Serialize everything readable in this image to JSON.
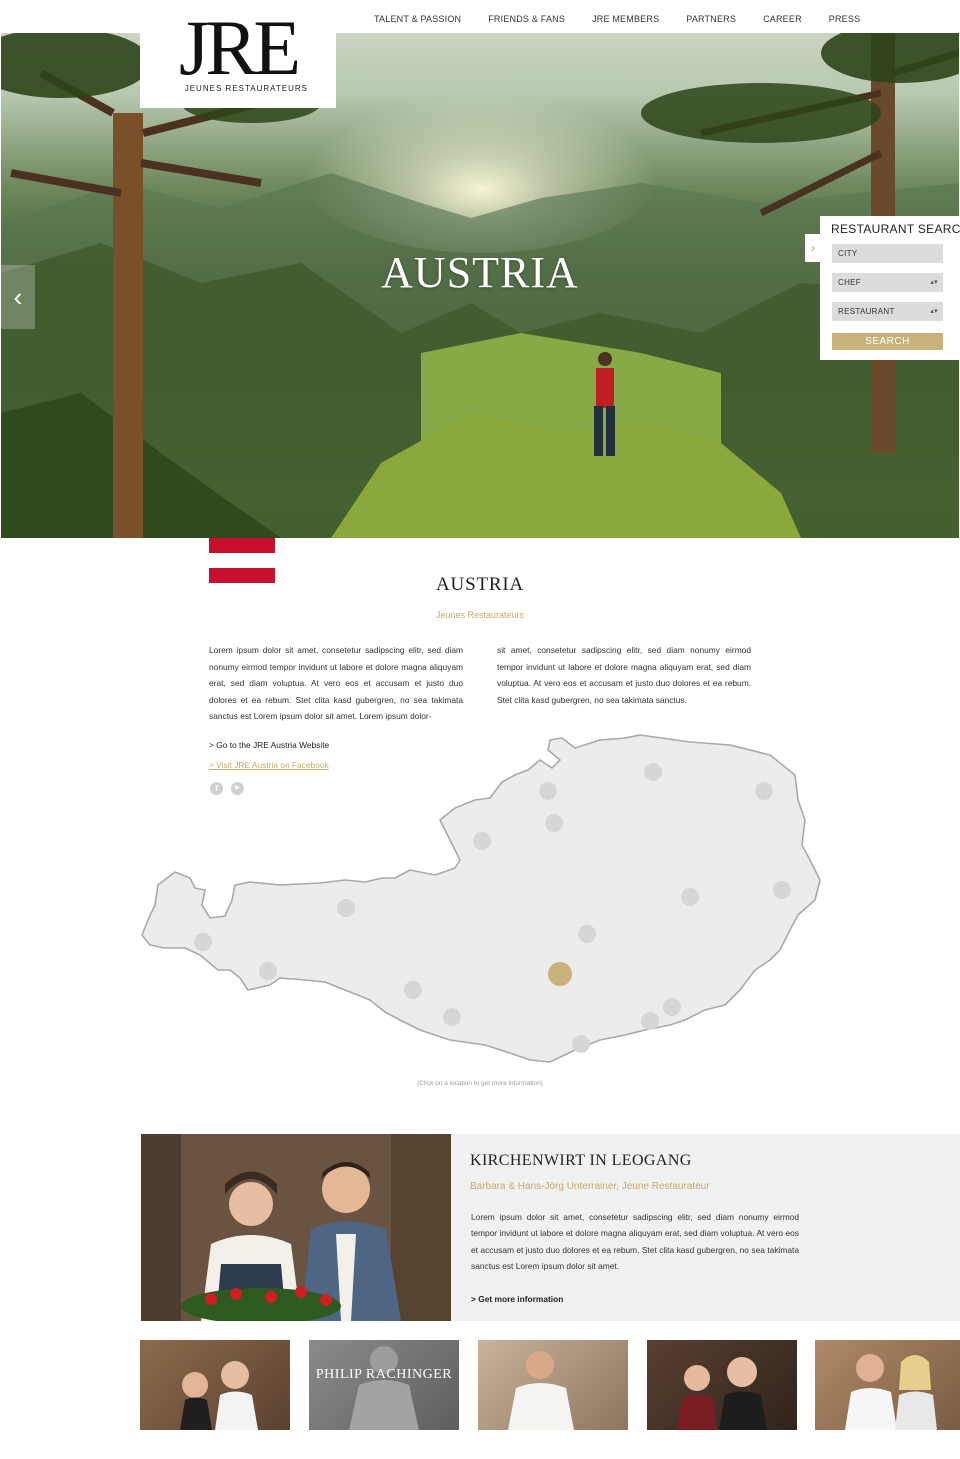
{
  "brand": {
    "logo_mark": "JRE",
    "logo_sub": "JEUNES RESTAURATEURS"
  },
  "nav": [
    "TALENT & PASSION",
    "FRIENDS & FANS",
    "JRE MEMBERS",
    "PARTNERS",
    "CAREER",
    "PRESS"
  ],
  "hero": {
    "title": "AUSTRIA",
    "prev_icon": "chevron-left-icon"
  },
  "search": {
    "title": "RESTAURANT SEARCH",
    "toggle_icon": "chevron-right-icon",
    "city_placeholder": "CITY",
    "chef_selected": "CHEF",
    "restaurant_selected": "RESTAURANT",
    "button": "SEARCH"
  },
  "intro": {
    "title": "AUSTRIA",
    "subtitle": "Jeunes Restaurateurs",
    "col1": "Lorem ipsum dolor sit amet, consetetur sadipscing elitr, sed diam nonumy eirmod tempor invidunt ut labore et dolore magna aliquyam erat, sed diam voluptua. At vero eos et accusam et justo duo dolores et ea rebum. Stet clita kasd gubergren, no sea takimata sanctus est Lorem ipsum dolor sit amet. Lorem ipsum dolor-",
    "col2": "sit amet, consetetur sadipscing elitr, sed diam nonumy eirmod tempor invidunt ut labore et dolore magna aliquyam erat, sed diam voluptua. At vero eos et accusam et justo duo dolores et ea rebum. Stet clita kasd gubergren, no sea takimata sanctus.",
    "link_website": "> Go to the JRE Austria Website",
    "link_facebook": "> Visit JRE Austria on Facebook",
    "social": [
      {
        "icon": "facebook-icon",
        "glyph": "f"
      },
      {
        "icon": "youtube-icon",
        "glyph": "▶"
      }
    ]
  },
  "map": {
    "hint": "(Click on a location to get more information)",
    "active_color": "#c9b27a",
    "dot_color": "#d6d6d6"
  },
  "featured": {
    "title": "KIRCHENWIRT IN LEOGANG",
    "subtitle": "Barbara & Hans-Jörg Unterrainer, Jeune Restaurateur",
    "text": "Lorem ipsum dolor sit amet, consetetur sadipscing elitr, sed diam nonumy eirmod tempor invidunt ut labore et dolore magna aliquyam erat, sed diam voluptua. At vero eos et accusam et justo duo dolores et ea rebum. Stet clita kasd gubergren, no sea takimata sanctus est Lorem ipsum dolor sit amet.",
    "more": "> Get more information"
  },
  "thumbnails": [
    {
      "caption": ""
    },
    {
      "caption": "PHILIP RACHINGER"
    },
    {
      "caption": ""
    },
    {
      "caption": ""
    },
    {
      "caption": ""
    }
  ],
  "colors": {
    "gold": "#c8a96a",
    "flag_red": "#c8102e",
    "panel_grey": "#f1f1f1"
  }
}
